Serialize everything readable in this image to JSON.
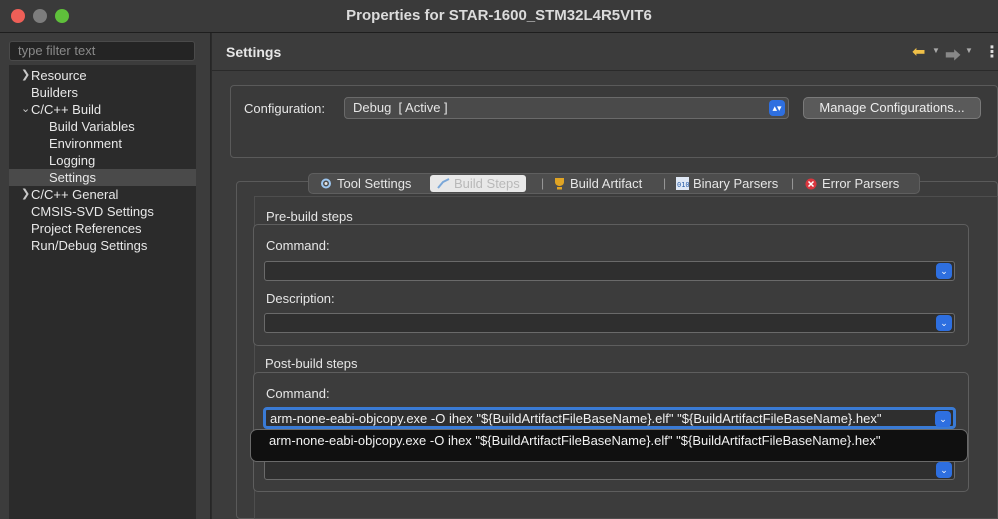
{
  "window": {
    "title": "Properties for STAR-1600_STM32L4R5VIT6"
  },
  "sidebar": {
    "filter_placeholder": "type filter text",
    "items": [
      {
        "label": "Resource",
        "chevron": ">"
      },
      {
        "label": "Builders"
      },
      {
        "label": "C/C++ Build",
        "chevron": "v"
      },
      {
        "label": "Build Variables"
      },
      {
        "label": "Environment"
      },
      {
        "label": "Logging"
      },
      {
        "label": "Settings",
        "selected": true
      },
      {
        "label": "C/C++ General",
        "chevron": ">"
      },
      {
        "label": "CMSIS-SVD Settings"
      },
      {
        "label": "Project References"
      },
      {
        "label": "Run/Debug Settings"
      }
    ]
  },
  "header": {
    "title": "Settings",
    "back_icon": "arrow-left-icon",
    "forward_icon": "arrow-right-icon",
    "menu_icon": "kebab-menu-icon"
  },
  "configuration": {
    "label": "Configuration:",
    "selected": "Debug  [ Active ]",
    "manage_label": "Manage Configurations..."
  },
  "tabs": [
    {
      "label": "Tool Settings",
      "icon": "tool-settings-icon"
    },
    {
      "label": "Build Steps",
      "icon": "build-steps-icon",
      "active": true
    },
    {
      "label": "Build Artifact",
      "icon": "trophy-icon"
    },
    {
      "label": "Binary Parsers",
      "icon": "binary-icon"
    },
    {
      "label": "Error Parsers",
      "icon": "error-icon"
    }
  ],
  "pre_build": {
    "title": "Pre-build steps",
    "command_label": "Command:",
    "command_value": "",
    "description_label": "Description:",
    "description_value": ""
  },
  "post_build": {
    "title": "Post-build steps",
    "command_label": "Command:",
    "command_value": "arm-none-eabi-objcopy.exe -O ihex \"${BuildArtifactFileBaseName}.elf\" \"${BuildArtifactFileBaseName}.hex\"",
    "suggestion": "arm-none-eabi-objcopy.exe -O ihex \"${BuildArtifactFileBaseName}.elf\" \"${BuildArtifactFileBaseName}.hex\""
  },
  "colors": {
    "accent": "#2e6fe0",
    "close": "#ee5f57",
    "maximize": "#5fc03b"
  }
}
